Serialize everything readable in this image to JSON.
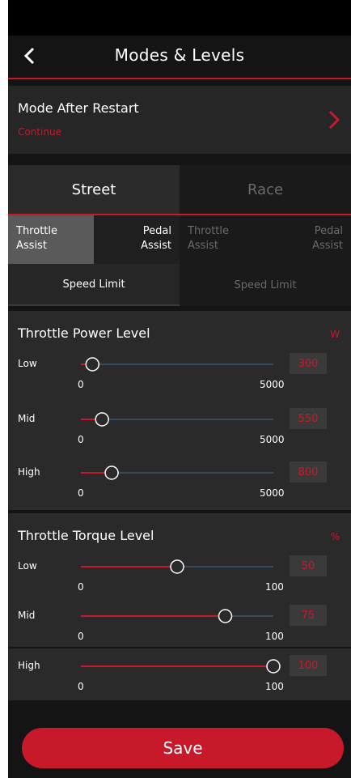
{
  "header": {
    "title": "Modes & Levels"
  },
  "restart": {
    "label": "Mode After Restart",
    "value": "Continue"
  },
  "modes": [
    {
      "label": "Street",
      "active": true
    },
    {
      "label": "Race",
      "active": false
    }
  ],
  "subtabs": [
    {
      "line1": "Throttle",
      "line2": "Assist"
    },
    {
      "line1": "Pedal",
      "line2": "Assist"
    },
    {
      "line1": "Throttle",
      "line2": "Assist"
    },
    {
      "line1": "Pedal",
      "line2": "Assist"
    }
  ],
  "speed_tabs": [
    {
      "label": "Speed Limit"
    },
    {
      "label": "Speed Limit"
    }
  ],
  "power": {
    "title": "Throttle Power Level",
    "unit": "W",
    "min": "0",
    "max": "5000",
    "rows": [
      {
        "label": "Low",
        "value": "300"
      },
      {
        "label": "Mid",
        "value": "550"
      },
      {
        "label": "High",
        "value": "800"
      }
    ]
  },
  "torque": {
    "title": "Throttle Torque Level",
    "unit": "%",
    "min": "0",
    "max": "100",
    "rows": [
      {
        "label": "Low",
        "value": "50"
      },
      {
        "label": "Mid",
        "value": "75"
      },
      {
        "label": "High",
        "value": "100"
      }
    ]
  },
  "save": {
    "label": "Save"
  },
  "colors": {
    "accent": "#c8192b",
    "track_blue": "#2f4b66",
    "panel": "#2a2a2a"
  }
}
